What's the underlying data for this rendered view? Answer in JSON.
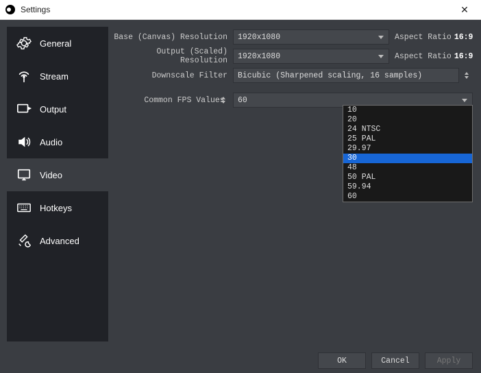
{
  "window": {
    "title": "Settings"
  },
  "sidebar": {
    "items": [
      {
        "label": "General"
      },
      {
        "label": "Stream"
      },
      {
        "label": "Output"
      },
      {
        "label": "Audio"
      },
      {
        "label": "Video"
      },
      {
        "label": "Hotkeys"
      },
      {
        "label": "Advanced"
      }
    ],
    "selected_index": 4
  },
  "video": {
    "base_label": "Base (Canvas) Resolution",
    "base_value": "1920x1080",
    "base_aspect_label": "Aspect Ratio",
    "base_aspect_value": "16:9",
    "output_label": "Output (Scaled) Resolution",
    "output_value": "1920x1080",
    "output_aspect_label": "Aspect Ratio",
    "output_aspect_value": "16:9",
    "filter_label": "Downscale Filter",
    "filter_value": "Bicubic (Sharpened scaling, 16 samples)",
    "fps_mode_label": "Common FPS Values",
    "fps_value": "60",
    "fps_options": [
      "10",
      "20",
      "24 NTSC",
      "25 PAL",
      "29.97",
      "30",
      "48",
      "50 PAL",
      "59.94",
      "60"
    ],
    "fps_highlight_index": 5
  },
  "footer": {
    "ok": "OK",
    "cancel": "Cancel",
    "apply": "Apply"
  }
}
